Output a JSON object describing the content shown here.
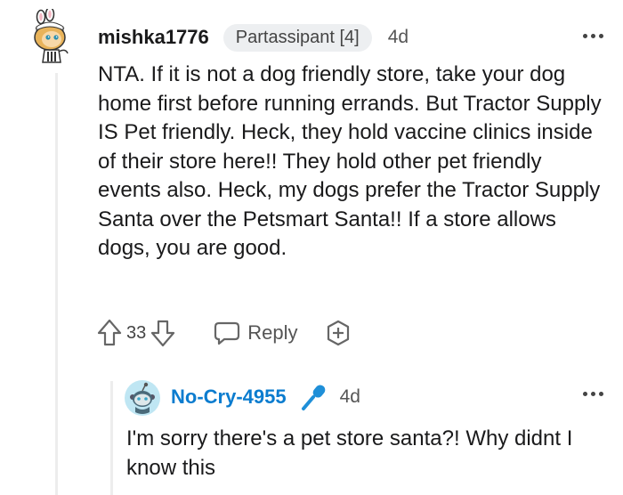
{
  "comment": {
    "username": "mishka1776",
    "flair": "Partassipant [4]",
    "timestamp": "4d",
    "body": "NTA. If it is not a dog friendly store, take your dog home first before running errands. But Tractor Supply IS Pet friendly. Heck, they hold vaccine clinics inside of their store here!! They hold other pet friendly events also. Heck, my dogs prefer the Tractor Supply Santa over the Petsmart Santa!! If a store allows dogs, you are good.",
    "score": "33",
    "reply_label": "Reply",
    "avatar_icon": "snoo-avatar-bunny-hat",
    "more_icon": "more-options-dots"
  },
  "reply": {
    "username": "No-Cry-4955",
    "timestamp": "4d",
    "body": "I'm sorry there's a pet store santa?! Why didnt I know this",
    "avatar_icon": "snoo-avatar-default",
    "badge_icon": "microphone-icon",
    "more_icon": "more-options-dots"
  },
  "colors": {
    "reply_username": "#0b7ccf",
    "thread_line": "#ededed",
    "flair_bg": "#edeff1"
  }
}
